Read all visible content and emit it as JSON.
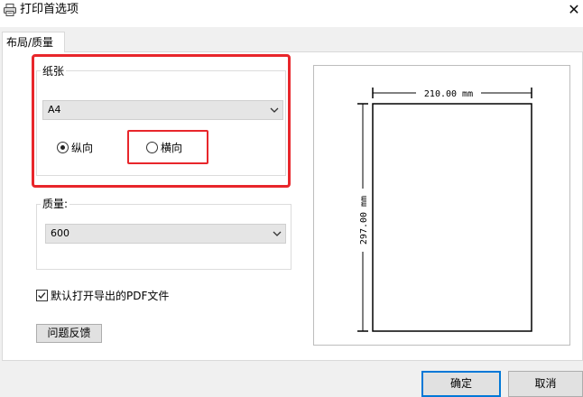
{
  "window": {
    "title": "打印首选项",
    "close_glyph": "✕"
  },
  "tab": {
    "label": "布局/质量"
  },
  "paper_group": {
    "label": "纸张",
    "size_value": "A4"
  },
  "orientation": {
    "options": [
      {
        "label": "纵向",
        "selected": true
      },
      {
        "label": "横向",
        "selected": false
      }
    ]
  },
  "quality_group": {
    "label": "质量:",
    "value": "600"
  },
  "open_pdf_checkbox": {
    "label": "默认打开导出的PDF文件",
    "checked": true
  },
  "feedback_button": {
    "label": "问题反馈"
  },
  "preview": {
    "width_label": "210.00 mm",
    "height_label": "297.00 mm"
  },
  "footer": {
    "ok_label": "确定",
    "cancel_label": "取消"
  },
  "colors": {
    "highlight": "#e8262b",
    "accent": "#0078d7",
    "client_bg": "#f0f0f0"
  },
  "icons": [
    "printer-icon",
    "close-icon",
    "chevron-down-icon",
    "checkmark-icon"
  ]
}
